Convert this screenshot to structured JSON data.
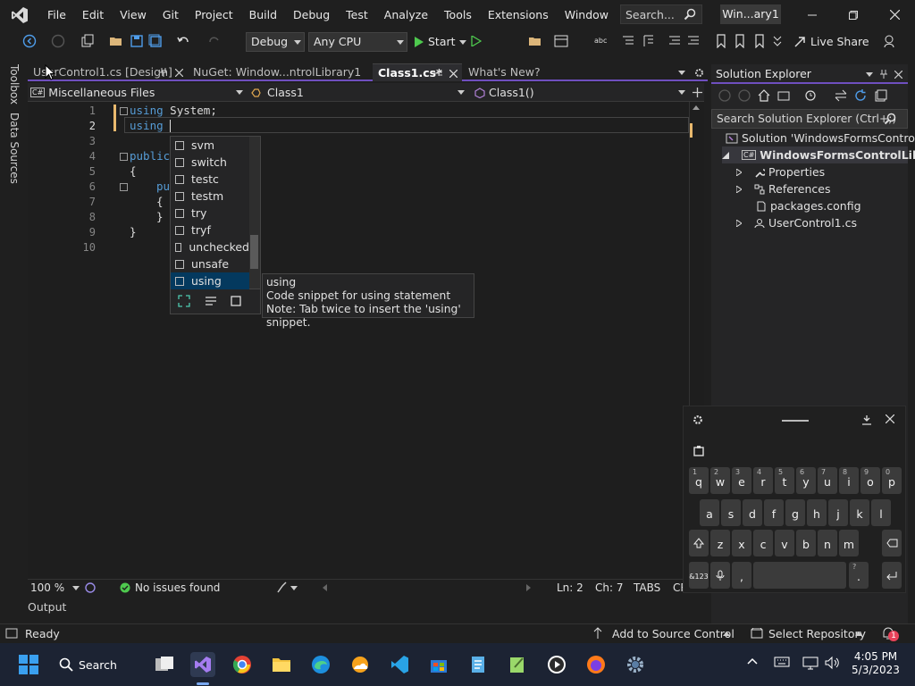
{
  "menu": {
    "items": [
      "File",
      "Edit",
      "View",
      "Git",
      "Project",
      "Build",
      "Debug",
      "Test",
      "Analyze",
      "Tools",
      "Extensions",
      "Window",
      "Help"
    ],
    "search_placeholder": "Search...",
    "window_title": "Win...ary1"
  },
  "toolbar": {
    "config": "Debug",
    "platform": "Any CPU",
    "start_label": "Start",
    "live_share_label": "Live Share"
  },
  "left_strip": {
    "toolbox": "Toolbox",
    "data_sources": "Data Sources"
  },
  "tabs": [
    {
      "label": "UserControl1.cs [Design]"
    },
    {
      "label": "NuGet: Window...ntrolLibrary1"
    },
    {
      "label": "Class1.cs*"
    },
    {
      "label": "What's New?"
    }
  ],
  "navbar": {
    "scope": "Miscellaneous Files",
    "type": "Class1",
    "member": "Class1()"
  },
  "editor": {
    "line_numbers": [
      "1",
      "2",
      "3",
      "4",
      "5",
      "6",
      "7",
      "8",
      "9",
      "10"
    ],
    "line1_kw": "using",
    "line1_rest": " System;",
    "line2_kw": "using",
    "line4_kw": "public",
    "line6_kw": "pu",
    "brace_open": "{",
    "brace_close": "}"
  },
  "completion": {
    "items": [
      "svm",
      "switch",
      "testc",
      "testm",
      "try",
      "tryf",
      "unchecked",
      "unsafe",
      "using"
    ],
    "selected": "using"
  },
  "tooltip": {
    "title": "using",
    "line1": "Code snippet for using statement",
    "line2": "Note: Tab twice to insert the 'using' snippet."
  },
  "editor_status": {
    "zoom": "100 %",
    "issues": "No issues found",
    "line": "Ln: 2",
    "col": "Ch: 7",
    "tabs": "TABS",
    "crlf": "CR"
  },
  "output_label": "Output",
  "solution_explorer": {
    "title": "Solution Explorer",
    "search_placeholder": "Search Solution Explorer (Ctrl+;)",
    "solution": "Solution 'WindowsFormsControlLib",
    "project": "WindowsFormsControlLibrary1",
    "properties": "Properties",
    "references": "References",
    "packages": "packages.config",
    "usercontrol": "UserControl1.cs"
  },
  "keyboard": {
    "row1": [
      {
        "k": "q",
        "s": "1"
      },
      {
        "k": "w",
        "s": "2"
      },
      {
        "k": "e",
        "s": "3"
      },
      {
        "k": "r",
        "s": "4"
      },
      {
        "k": "t",
        "s": "5"
      },
      {
        "k": "y",
        "s": "6"
      },
      {
        "k": "u",
        "s": "7"
      },
      {
        "k": "i",
        "s": "8"
      },
      {
        "k": "o",
        "s": "9"
      },
      {
        "k": "p",
        "s": "0"
      }
    ],
    "row2": [
      "a",
      "s",
      "d",
      "f",
      "g",
      "h",
      "j",
      "k",
      "l"
    ],
    "row3": [
      "z",
      "x",
      "c",
      "v",
      "b",
      "n",
      "m"
    ],
    "symbols_key": "&123",
    "comma": ",",
    "period": ".",
    "period_sup": "?"
  },
  "statusbar": {
    "ready": "Ready",
    "add_source": "Add to Source Control",
    "select_repo": "Select Repository",
    "notif_count": "1"
  },
  "taskbar": {
    "search_label": "Search",
    "time": "4:05 PM",
    "date": "5/3/2023"
  },
  "colors": {
    "accent": "#6f4fbf",
    "keyword": "#569cd6",
    "selection": "#04395e",
    "taskbar_bg": "#1c2333"
  }
}
